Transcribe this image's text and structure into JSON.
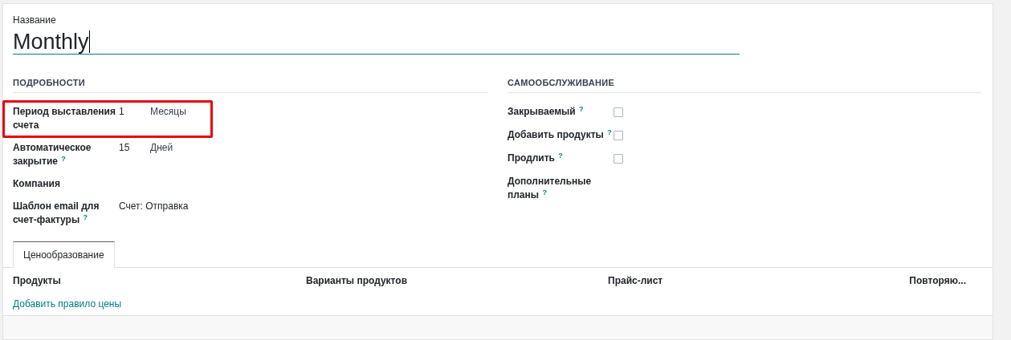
{
  "name_field": {
    "label": "Название",
    "value": "Monthly"
  },
  "details": {
    "title": "ПОДРОБНОСТИ",
    "fields": [
      {
        "label": "Период выставления счета",
        "value": "1",
        "unit": "Месяцы",
        "highlighted": true
      },
      {
        "label": "Автоматическое закрытие",
        "help": "?",
        "value": "15",
        "unit": "Дней",
        "highlighted": false
      },
      {
        "label": "Компания",
        "highlighted": false
      },
      {
        "label": "Шаблон email для счет-фактуры",
        "help": "?",
        "value": "Счет: Отправка",
        "highlighted": false
      }
    ]
  },
  "self_service": {
    "title": "САМООБСЛУЖИВАНИЕ",
    "fields": [
      {
        "label": "Закрываемый",
        "help": "?",
        "kind": "checkbox",
        "checked": false
      },
      {
        "label": "Добавить продукты",
        "help": "?",
        "kind": "checkbox",
        "checked": false
      },
      {
        "label": "Продлить",
        "help": "?",
        "kind": "checkbox",
        "checked": false
      },
      {
        "label": "Дополнительные планы",
        "help": "?",
        "kind": "empty"
      }
    ]
  },
  "tabs": [
    {
      "label": "Ценообразование",
      "selected": true
    }
  ],
  "table": {
    "columns": [
      "Продукты",
      "Варианты продуктов",
      "Прайс-лист",
      "Повторяю..."
    ],
    "add_link": "Добавить правило цены"
  }
}
